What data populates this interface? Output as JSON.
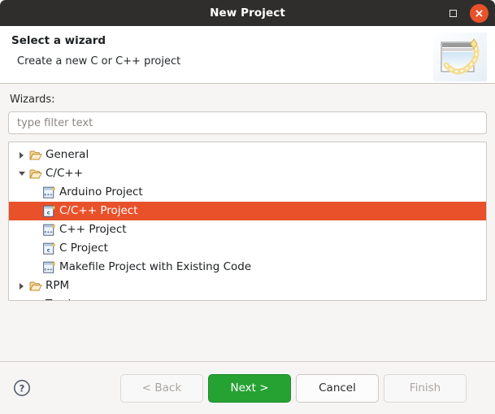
{
  "window": {
    "title": "New Project",
    "maximize_icon": "maximize-icon",
    "close_icon": "close-icon"
  },
  "header": {
    "title": "Select a wizard",
    "description": "Create a new C or C++ project",
    "banner_icon": "wizard-banner-icon"
  },
  "main": {
    "wizards_label": "Wizards:",
    "filter": {
      "value": "",
      "placeholder": "type filter text"
    },
    "tree": [
      {
        "label": "General",
        "level": 0,
        "type": "folder",
        "state": "collapsed",
        "icon": "folder-icon",
        "selected": false
      },
      {
        "label": "C/C++",
        "level": 0,
        "type": "folder",
        "state": "expanded",
        "icon": "folder-icon",
        "selected": false
      },
      {
        "label": "Arduino Project",
        "level": 1,
        "type": "wizard",
        "icon": "cpp-project-icon",
        "selected": false
      },
      {
        "label": "C/C++ Project",
        "level": 1,
        "type": "wizard",
        "icon": "c-project-icon",
        "selected": true
      },
      {
        "label": "C++ Project",
        "level": 1,
        "type": "wizard",
        "icon": "cpp-project-icon",
        "selected": false
      },
      {
        "label": "C Project",
        "level": 1,
        "type": "wizard",
        "icon": "c-project-icon",
        "selected": false
      },
      {
        "label": "Makefile Project with Existing Code",
        "level": 1,
        "type": "wizard",
        "icon": "cpp-project-icon",
        "selected": false
      },
      {
        "label": "RPM",
        "level": 0,
        "type": "folder",
        "state": "collapsed",
        "icon": "folder-icon",
        "selected": false
      },
      {
        "label": "Tracing",
        "level": 0,
        "type": "folder",
        "state": "collapsed",
        "icon": "folder-icon",
        "selected": false
      }
    ]
  },
  "footer": {
    "help_icon": "help-icon",
    "buttons": [
      {
        "label": "< Back",
        "state": "disabled",
        "name": "back-button"
      },
      {
        "label": "Next >",
        "state": "primary",
        "name": "next-button"
      },
      {
        "label": "Cancel",
        "state": "normal",
        "name": "cancel-button"
      },
      {
        "label": "Finish",
        "state": "disabled",
        "name": "finish-button"
      }
    ]
  },
  "colors": {
    "titlebar_bg": "#302e2c",
    "close_button": "#e9512a",
    "selection": "#e9512a",
    "primary_button": "#26a233",
    "body_bg": "#f6f5f4",
    "folder_icon": "#d9a443"
  }
}
